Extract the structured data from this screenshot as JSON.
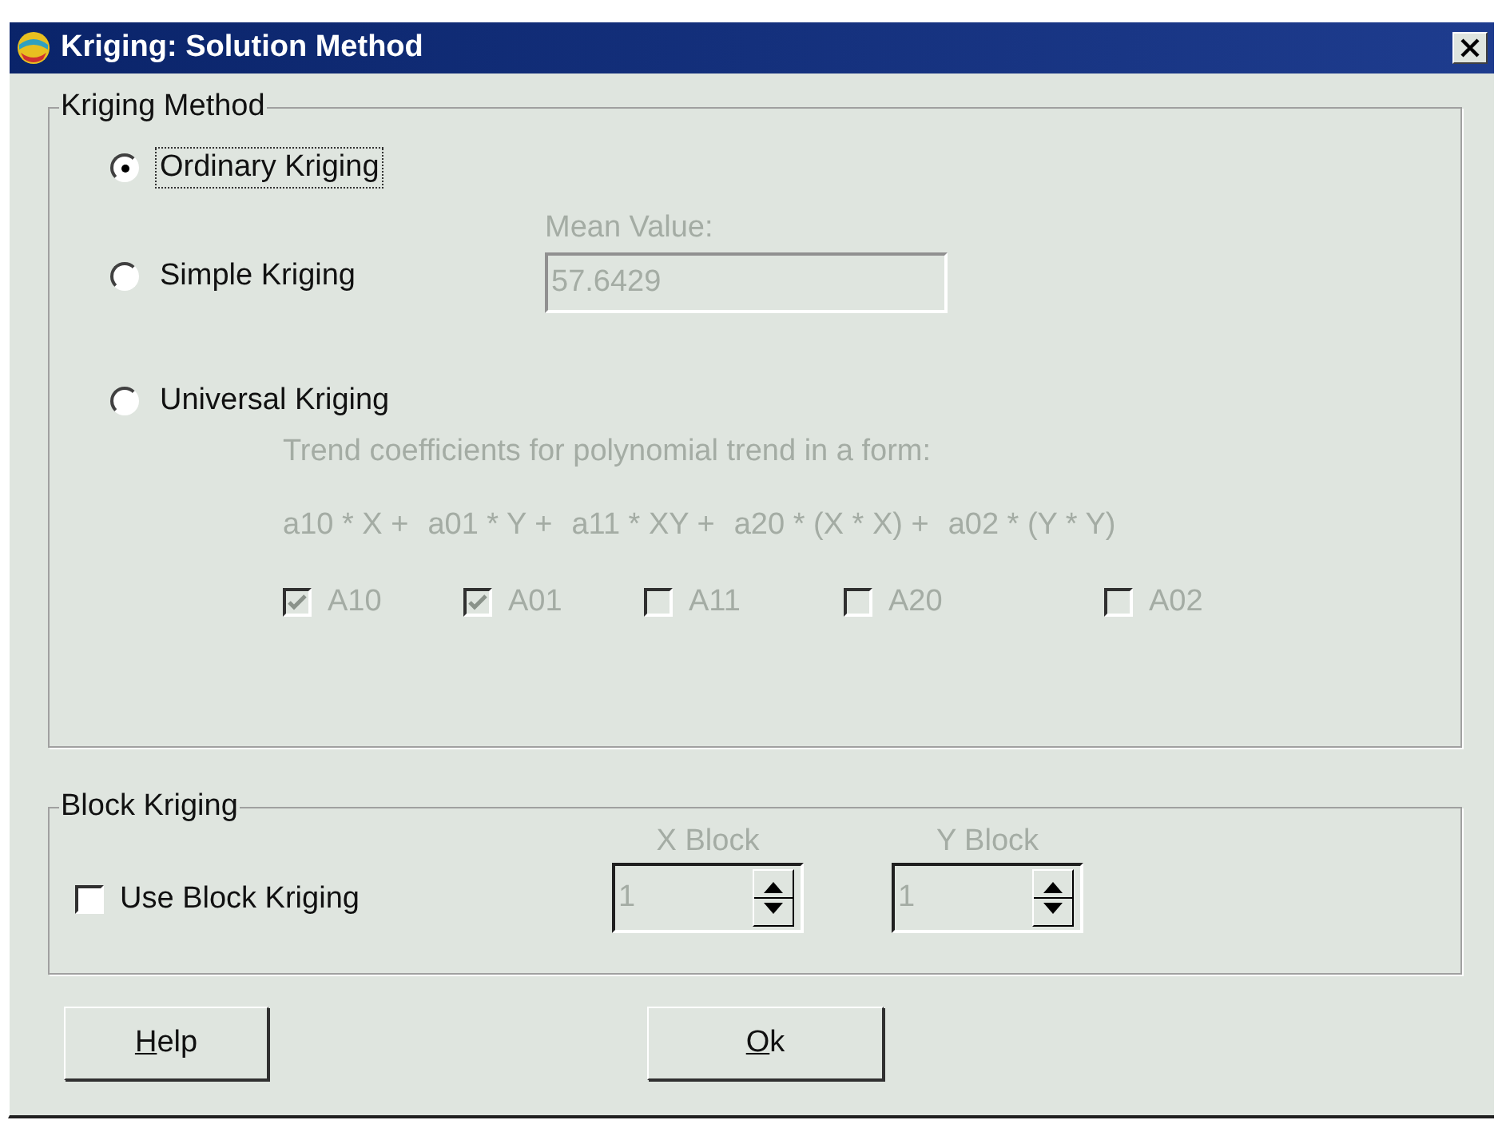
{
  "window": {
    "title": "Kriging: Solution Method"
  },
  "kriging_method": {
    "title": "Kriging Method",
    "options": [
      {
        "label": "Ordinary Kriging",
        "selected": true,
        "focused": true
      },
      {
        "label": "Simple Kriging",
        "selected": false,
        "focused": false
      },
      {
        "label": "Universal Kriging",
        "selected": false,
        "focused": false
      }
    ],
    "mean_value": {
      "label": "Mean Value:",
      "value": "57.6429",
      "disabled": true
    },
    "trend": {
      "caption": "Trend coefficients for polynomial trend in a form:",
      "formula": [
        "a10 * X +",
        "a01 * Y +",
        "a11 * XY +",
        "a20 * (X * X) +",
        "a02 * (Y * Y)"
      ],
      "disabled": true,
      "coefficients": [
        {
          "label": "A10",
          "checked": true
        },
        {
          "label": "A01",
          "checked": true
        },
        {
          "label": "A11",
          "checked": false
        },
        {
          "label": "A20",
          "checked": false
        },
        {
          "label": "A02",
          "checked": false
        }
      ]
    }
  },
  "block_kriging": {
    "title": "Block Kriging",
    "use": {
      "label": "Use Block Kriging",
      "checked": false
    },
    "spinners": [
      {
        "label": "X Block",
        "value": "1",
        "disabled": true
      },
      {
        "label": "Y Block",
        "value": "1",
        "disabled": true
      }
    ]
  },
  "buttons": [
    {
      "mnemonic": "H",
      "rest": "elp"
    },
    {
      "mnemonic": "O",
      "rest": "k"
    }
  ]
}
